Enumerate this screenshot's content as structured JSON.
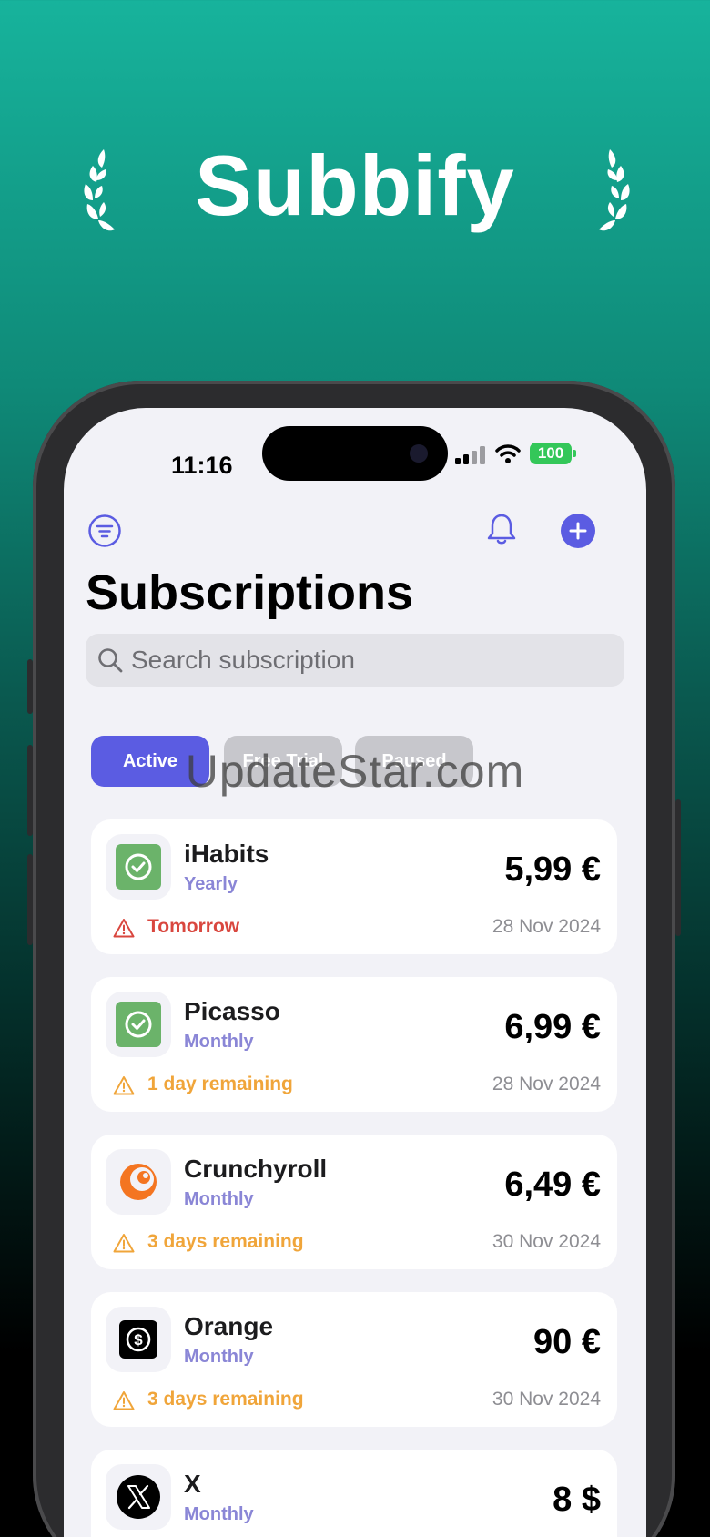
{
  "hero": {
    "title": "Subbify"
  },
  "status_bar": {
    "time": "11:16",
    "battery": "100"
  },
  "header": {
    "title": "Subscriptions"
  },
  "search": {
    "placeholder": "Search subscription"
  },
  "tabs": [
    {
      "label": "Active"
    },
    {
      "label": "Free Trial"
    },
    {
      "label": "Paused"
    }
  ],
  "watermark": "UpdateStar.com",
  "subscriptions": [
    {
      "name": "iHabits",
      "period": "Yearly",
      "price": "5,99 €",
      "status": "Tomorrow",
      "status_color": "#d9473f",
      "date": "28 Nov 2024",
      "icon": "check-square-icon"
    },
    {
      "name": "Picasso",
      "period": "Monthly",
      "price": "6,99 €",
      "status": "1 day remaining",
      "status_color": "#f0a53a",
      "date": "28 Nov 2024",
      "icon": "check-square-icon"
    },
    {
      "name": "Crunchyroll",
      "period": "Monthly",
      "price": "6,49 €",
      "status": "3 days remaining",
      "status_color": "#f0a53a",
      "date": "30 Nov 2024",
      "icon": "crunchyroll-icon"
    },
    {
      "name": "Orange",
      "period": "Monthly",
      "price": "90 €",
      "status": "3 days remaining",
      "status_color": "#f0a53a",
      "date": "30 Nov 2024",
      "icon": "dollar-icon"
    },
    {
      "name": "X",
      "period": "Monthly",
      "price": "8 $",
      "status": "",
      "date": "",
      "icon": "x-logo-icon"
    }
  ],
  "colors": {
    "accent": "#5b5ce2",
    "danger": "#d9473f",
    "warning": "#f0a53a"
  }
}
